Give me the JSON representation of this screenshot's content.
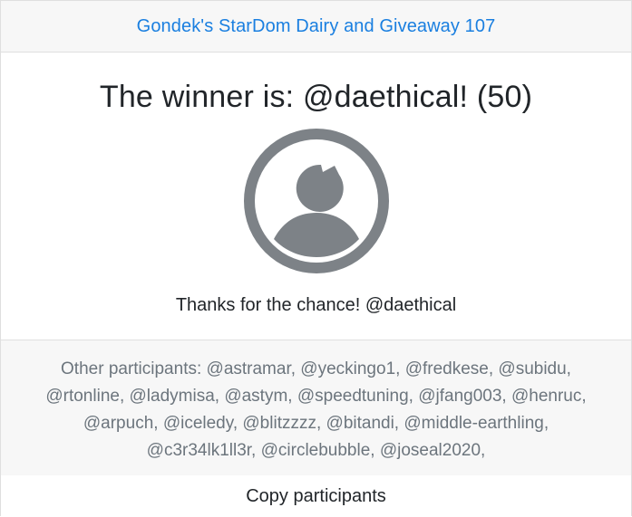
{
  "header": {
    "title": "Gondek's StarDom Dairy and Giveaway 107"
  },
  "winner": {
    "title": "The winner is: @daethical! (50)",
    "avatar_icon": "user-avatar-icon",
    "comment": "Thanks for the chance! @daethical"
  },
  "footer": {
    "participants_text": "Other participants: @astramar, @yeckingo1, @fredkese, @subidu, @rtonline, @ladymisa, @astym, @speedtuning, @jfang003, @henruc, @arpuch, @iceledy, @blitzzzz, @bitandi, @middle-earthling, @c3r34lk1ll3r, @circlebubble, @joseal2020,",
    "copy_label": "Copy participants"
  },
  "colors": {
    "link": "#1a7fe0",
    "avatar": "#7d8287",
    "muted_text": "#6c757d",
    "panel_bg": "#f7f7f7"
  }
}
